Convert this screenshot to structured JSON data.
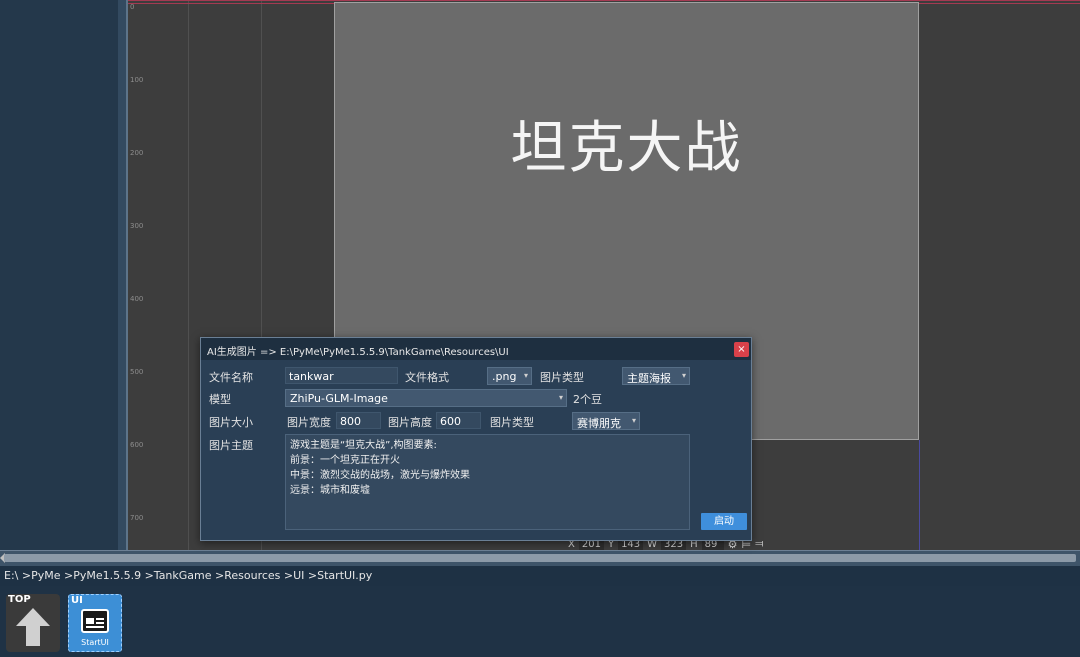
{
  "canvas": {
    "ruler_labels": [
      "0",
      "100",
      "200",
      "300",
      "400",
      "500",
      "600",
      "700"
    ],
    "frame_title": "坦克大战",
    "coords": {
      "x_label": "X",
      "x_value": "201",
      "y_label": "Y",
      "y_value": "143",
      "w_label": "W",
      "w_value": "323",
      "h_label": "H",
      "h_value": "89"
    }
  },
  "dialog": {
    "title": "AI生成图片 => E:\\PyMe\\PyMe1.5.5.9\\TankGame\\Resources\\UI",
    "close_label": "×",
    "file_name_label": "文件名称",
    "file_name_value": "tankwar",
    "file_format_label": "文件格式",
    "file_format_value": ".png",
    "image_type_label": "图片类型",
    "image_type_value": "主题海报",
    "model_label": "模型",
    "model_value": "ZhiPu-GLM-Image",
    "cost_text": "2个豆",
    "image_size_label": "图片大小",
    "width_label": "图片宽度",
    "width_value": "800",
    "height_label": "图片高度",
    "height_value": "600",
    "style_label": "图片类型",
    "style_value": "赛博朋克",
    "theme_label": "图片主题",
    "prompt_text": "游戏主题是“坦克大战”,构图要素:\n前景：一个坦克正在开火\n中景：激烈交战的战场，激光与爆炸效果\n远景：城市和废墟",
    "start_label": "启动"
  },
  "breadcrumb": "E:\\ >PyMe >PyMe1.5.5.9 >TankGame >Resources >UI >StartUI.py",
  "files": {
    "top_tag": "TOP",
    "ui_tag": "UI",
    "ui_name": "StartUI"
  },
  "colors": {
    "accent": "#3f8fdc",
    "close": "#d9414a",
    "guide_red": "#a43a52"
  }
}
